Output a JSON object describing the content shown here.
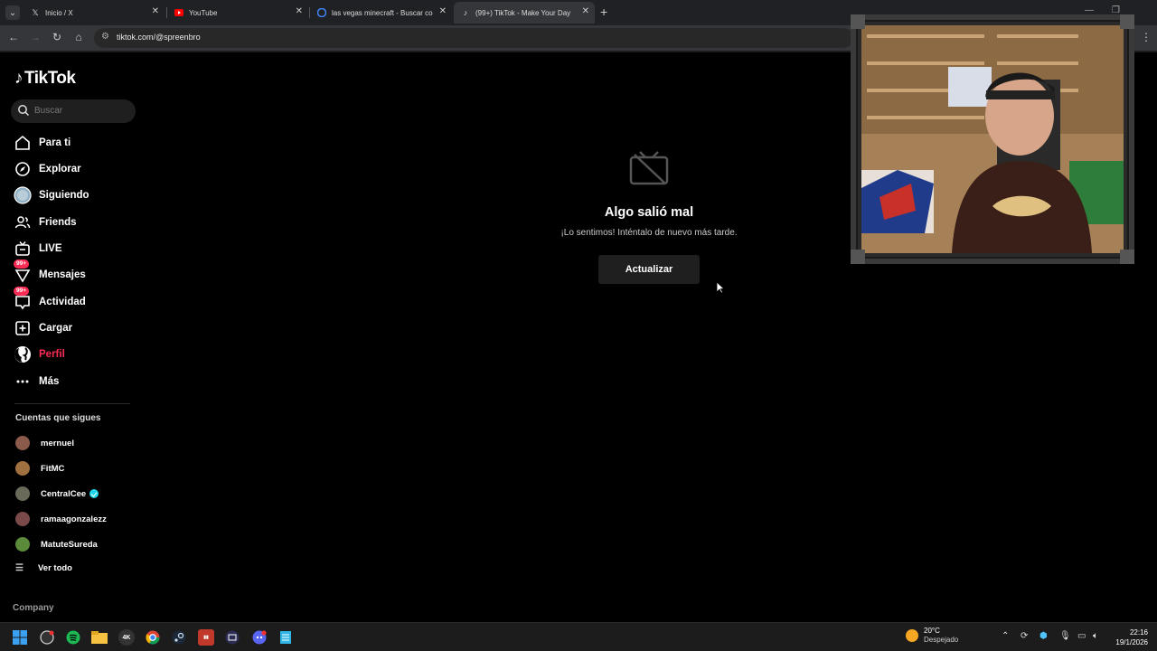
{
  "browser": {
    "tabs": [
      {
        "title": "Inicio / X",
        "icon": "x-logo-icon",
        "active": false
      },
      {
        "title": "YouTube",
        "icon": "youtube-icon",
        "active": false
      },
      {
        "title": "las vegas minecraft - Buscar co",
        "icon": "google-icon",
        "active": false
      },
      {
        "title": "(99+) TikTok - Make Your Day",
        "icon": "tiktok-icon",
        "active": true
      }
    ],
    "url": "tiktok.com/@spreenbro"
  },
  "sidebar": {
    "logo": "TikTok",
    "search_placeholder": "Buscar",
    "nav": [
      {
        "label": "Para ti",
        "icon": "home-icon"
      },
      {
        "label": "Explorar",
        "icon": "compass-icon"
      },
      {
        "label": "Siguiendo",
        "icon": "following-icon"
      },
      {
        "label": "Friends",
        "icon": "friends-icon"
      },
      {
        "label": "LIVE",
        "icon": "live-icon"
      },
      {
        "label": "Mensajes",
        "icon": "messages-icon",
        "badge": "99+"
      },
      {
        "label": "Actividad",
        "icon": "activity-icon",
        "badge": "99+"
      },
      {
        "label": "Cargar",
        "icon": "upload-icon"
      },
      {
        "label": "Perfil",
        "icon": "profile-icon",
        "active": true
      },
      {
        "label": "Más",
        "icon": "more-icon"
      }
    ],
    "following_title": "Cuentas que sigues",
    "following": [
      {
        "name": "mernuel",
        "color": "#8a5a4a"
      },
      {
        "name": "FitMC",
        "color": "#a07040"
      },
      {
        "name": "CentralCee",
        "color": "#6a6a5a",
        "verified": true
      },
      {
        "name": "ramaagonzalezz",
        "color": "#7a4a4a"
      },
      {
        "name": "MatuteSureda",
        "color": "#5a8a3a"
      }
    ],
    "view_all": "Ver todo",
    "company": "Company"
  },
  "main": {
    "error_title": "Algo salió mal",
    "error_message": "¡Lo sentimos! Inténtalo de nuevo más tarde.",
    "refresh_label": "Actualizar"
  },
  "taskbar": {
    "weather_temp": "20°C",
    "weather_cond": "Despejado",
    "weather_badge": "6",
    "time": "22:16",
    "date": "19/1/2026"
  }
}
